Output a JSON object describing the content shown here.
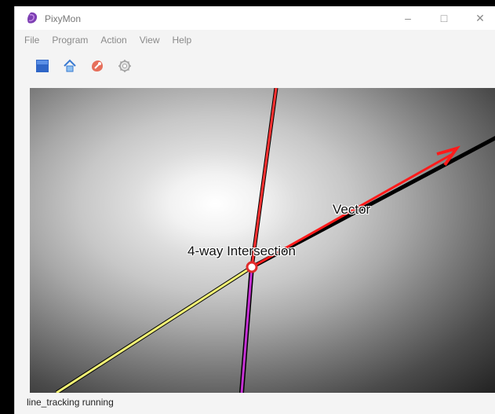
{
  "window": {
    "title": "PixyMon",
    "accent_color": "#7d3fb3",
    "controls": {
      "minimize": "–",
      "maximize": "□",
      "close": "✕"
    }
  },
  "menu": [
    {
      "label": "File"
    },
    {
      "label": "Program"
    },
    {
      "label": "Action"
    },
    {
      "label": "View"
    },
    {
      "label": "Help"
    }
  ],
  "toolbar": {
    "icons": [
      {
        "name": "blue-square-icon"
      },
      {
        "name": "home-icon"
      },
      {
        "name": "red-program-icon"
      },
      {
        "name": "settings-gear-icon"
      }
    ]
  },
  "viewport": {
    "labels": {
      "vector": "Vector",
      "intersection": "4-way Intersection"
    },
    "colors": {
      "red_line": "#ff3131",
      "vector_line": "#ff1a1a",
      "yellow_line": "#f2f276",
      "magenta_line": "#c531d4",
      "intersection": "#e02b2b"
    }
  },
  "status": {
    "text": "line_tracking running"
  }
}
